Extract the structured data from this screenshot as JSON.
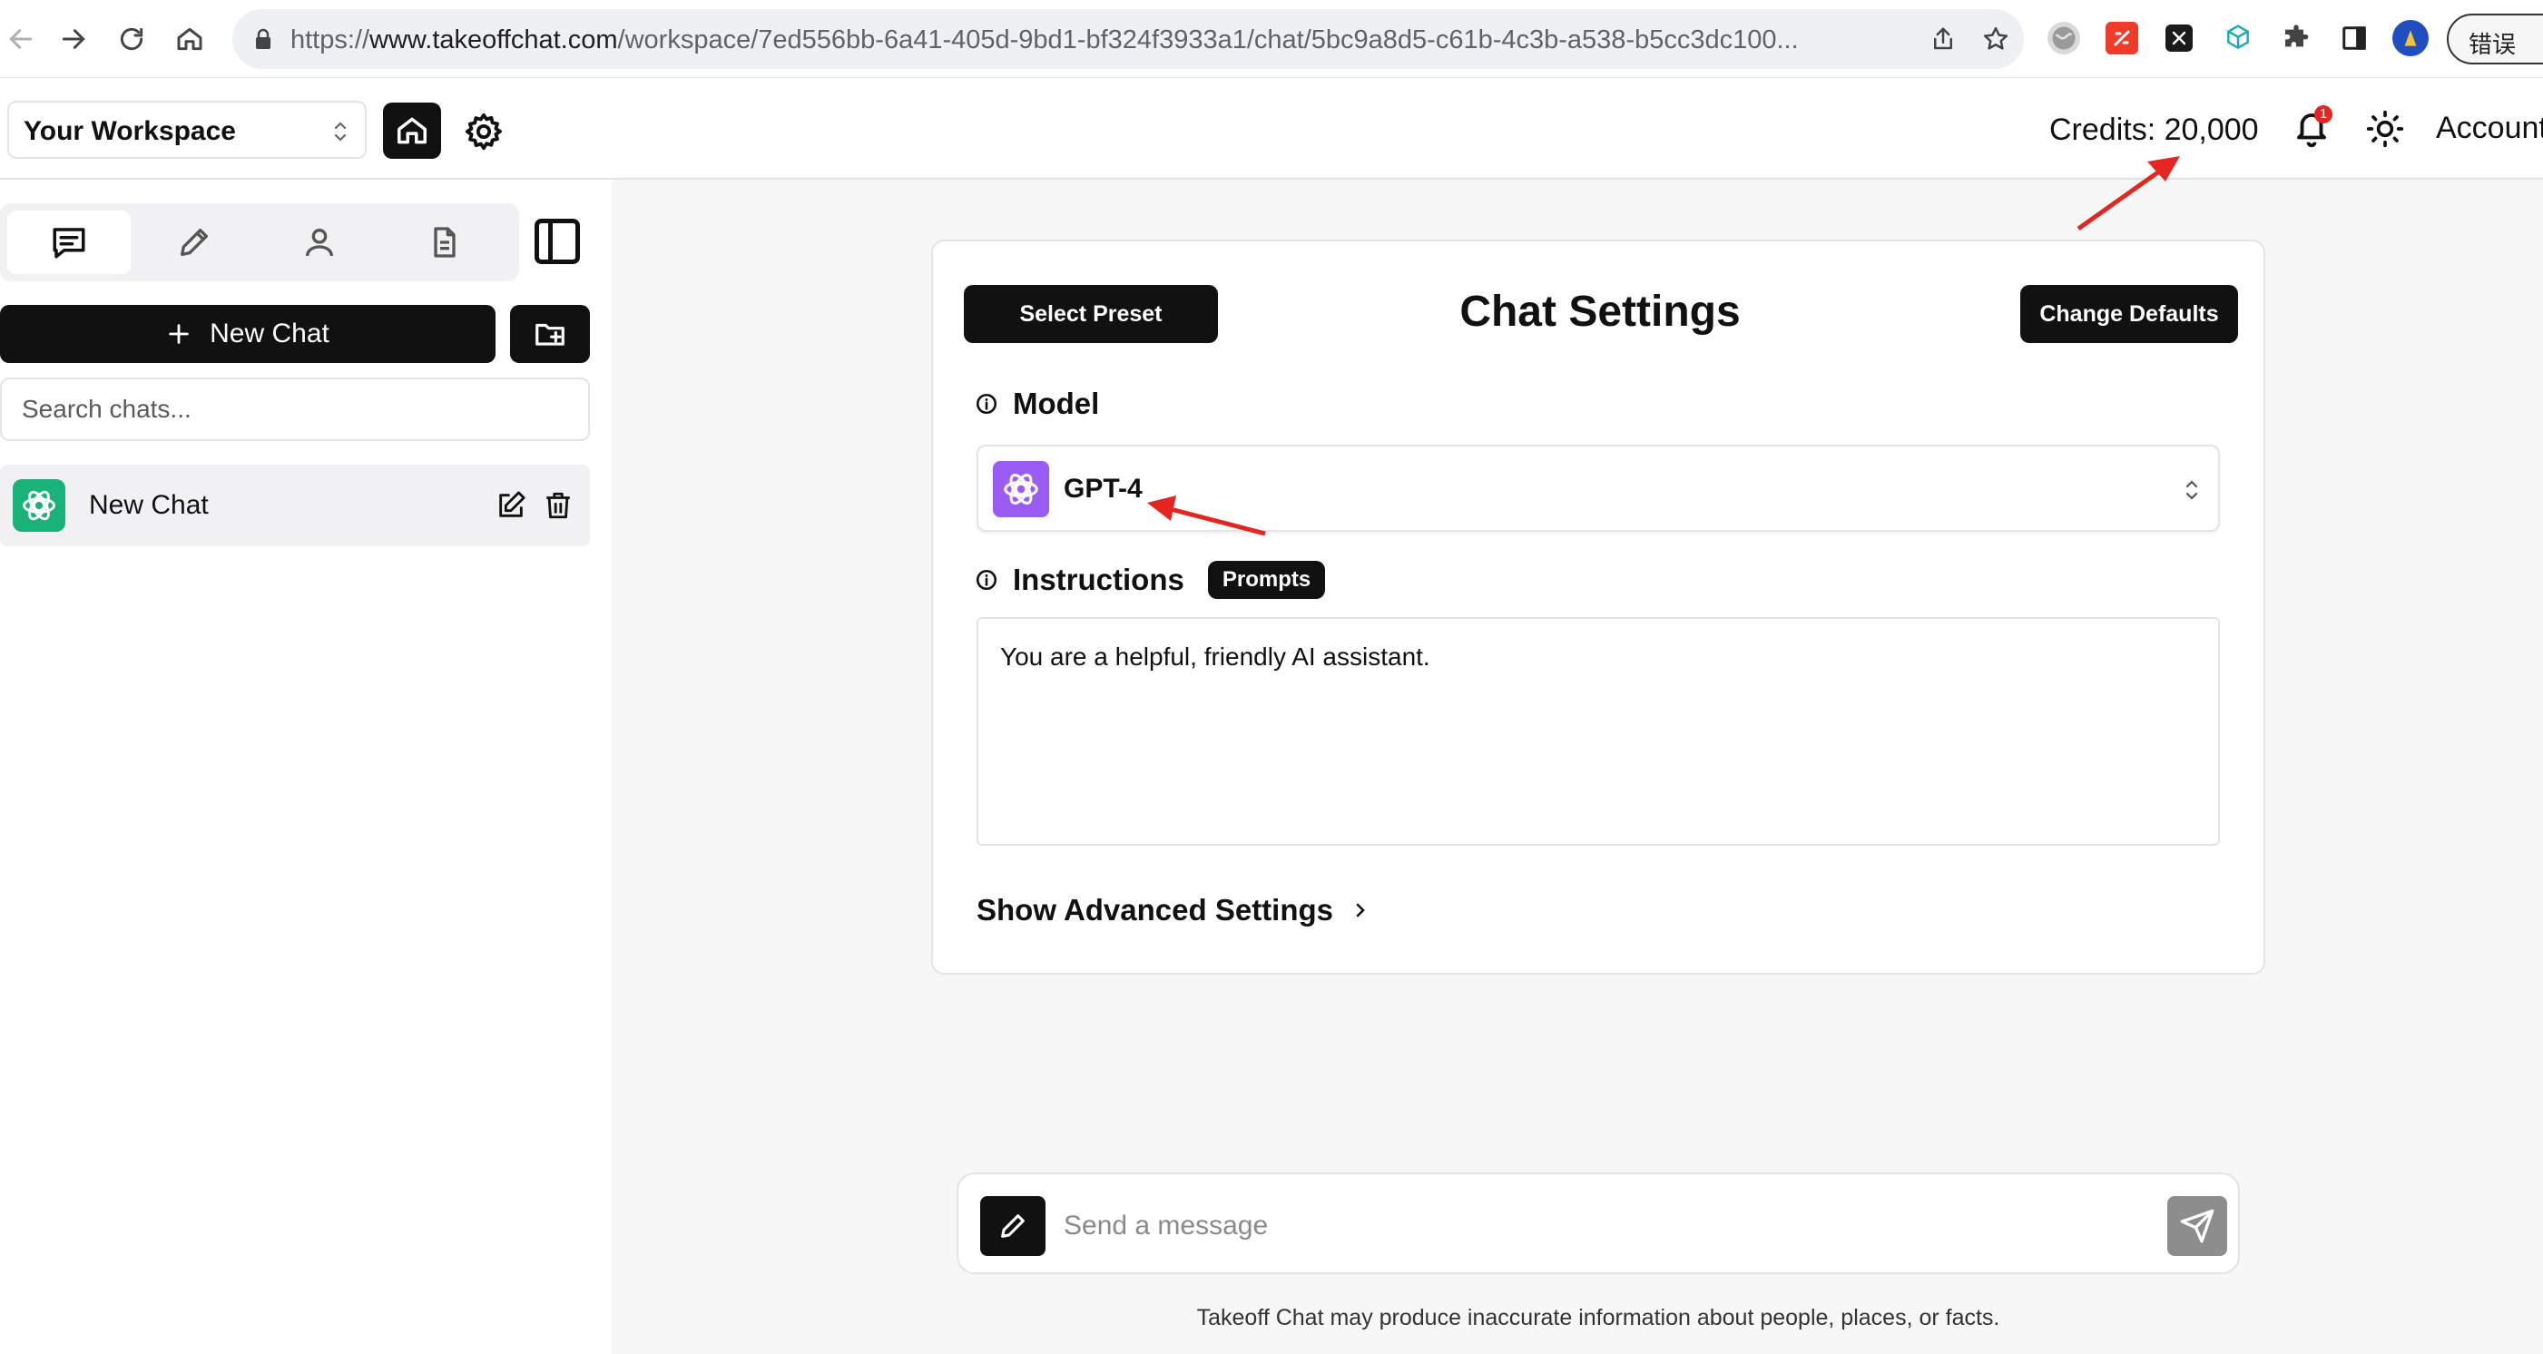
{
  "browser": {
    "url_prefix": "https://",
    "url_host": "www.takeoffchat.com",
    "url_path": "/workspace/7ed556bb-6a41-405d-9bd1-bf324f3933a1/chat/5bc9a8d5-c61b-4c3b-a538-b5cc3dc100...",
    "error_pill": "错误"
  },
  "header": {
    "workspace": "Your Workspace",
    "credits": "Credits: 20,000",
    "notification_count": "1",
    "account": "Account"
  },
  "sidebar": {
    "tabs": [
      {
        "icon": "chat-icon",
        "active": true
      },
      {
        "icon": "pencil-icon",
        "active": false
      },
      {
        "icon": "user-icon",
        "active": false
      },
      {
        "icon": "document-icon",
        "active": false
      }
    ],
    "new_chat_label": "New Chat",
    "search_placeholder": "Search chats...",
    "chats": [
      {
        "title": "New Chat"
      }
    ]
  },
  "chat_settings": {
    "select_preset": "Select Preset",
    "title": "Chat Settings",
    "change_defaults": "Change Defaults",
    "model_label": "Model",
    "model_value": "GPT-4",
    "instructions_label": "Instructions",
    "prompts_badge": "Prompts",
    "instructions_value": "You are a helpful, friendly AI assistant.",
    "advanced_label": "Show Advanced Settings"
  },
  "composer": {
    "placeholder": "Send a message",
    "disclaimer": "Takeoff Chat may produce inaccurate information about people, places, or facts."
  },
  "colors": {
    "brand_dark": "#111111",
    "model_logo": "#9b5cf6",
    "chat_logo": "#19b37a",
    "annotation_arrow": "#e5251f"
  }
}
